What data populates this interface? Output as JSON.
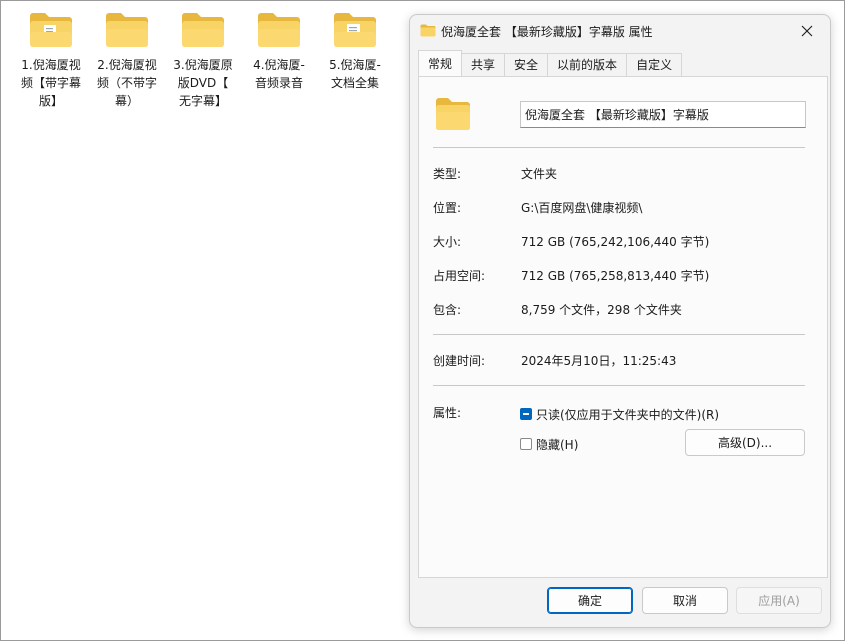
{
  "desktop": {
    "folders": [
      {
        "name": "1.倪海厦视\n频【带字幕\n版】"
      },
      {
        "name": "2.倪海厦视\n频（不带字\n幕）"
      },
      {
        "name": "3.倪海厦原\n版DVD【\n无字幕】"
      },
      {
        "name": "4.倪海厦-\n音频录音"
      },
      {
        "name": "5.倪海厦-\n文档全集"
      }
    ]
  },
  "dialog": {
    "title": "倪海厦全套 【最新珍藏版】字幕版 属性",
    "tabs": [
      "常规",
      "共享",
      "安全",
      "以前的版本",
      "自定义"
    ],
    "active_tab": "常规",
    "folder_name": "倪海厦全套 【最新珍藏版】字幕版",
    "rows": {
      "type": {
        "label": "类型:",
        "value": "文件夹"
      },
      "location": {
        "label": "位置:",
        "value": "G:\\百度网盘\\健康视频\\"
      },
      "size": {
        "label": "大小:",
        "value": "712 GB (765,242,106,440 字节)"
      },
      "size_on_disk": {
        "label": "占用空间:",
        "value": "712 GB (765,258,813,440 字节)"
      },
      "contains": {
        "label": "包含:",
        "value": "8,759 个文件，298 个文件夹"
      },
      "created": {
        "label": "创建时间:",
        "value": "2024年5月10日，11:25:43"
      }
    },
    "attributes": {
      "label": "属性:",
      "readonly_label": "只读(仅应用于文件夹中的文件)(R)",
      "readonly_state": "indeterminate",
      "hidden_label": "隐藏(H)",
      "hidden_state": "unchecked",
      "advanced_button": "高级(D)..."
    },
    "buttons": {
      "ok": "确定",
      "cancel": "取消",
      "apply": "应用(A)"
    }
  },
  "colors": {
    "accent": "#0067c0",
    "folder": "#f8d466",
    "folder_dark": "#e8b73e"
  }
}
